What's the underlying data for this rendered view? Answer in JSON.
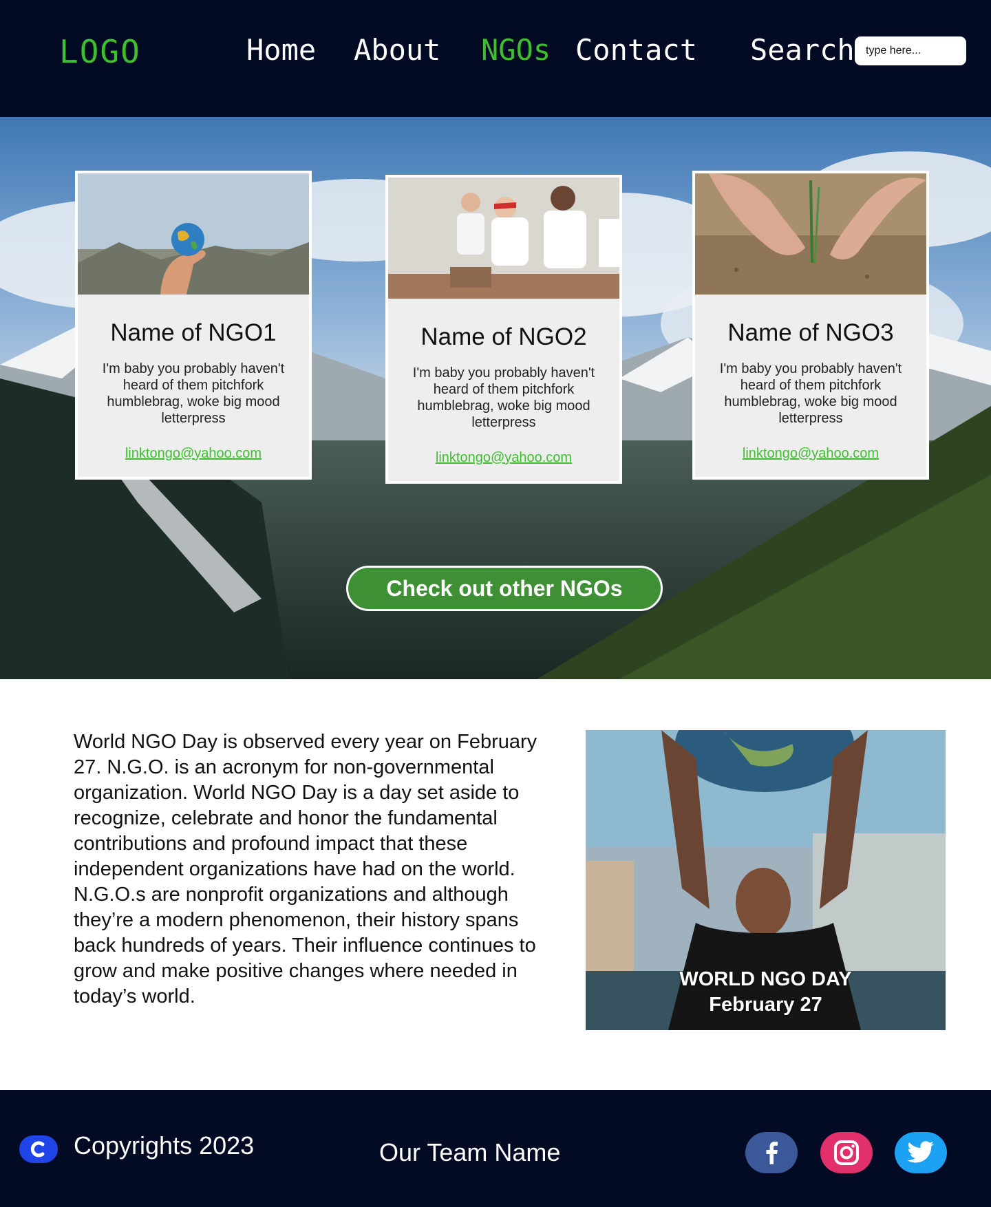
{
  "nav": {
    "logo": "LOGO",
    "links": [
      "Home",
      "About",
      "NGOs",
      "Contact"
    ],
    "active": "NGOs",
    "search_label": "Search",
    "search_placeholder": "type here..."
  },
  "cards": [
    {
      "title": "Name of NGO1",
      "text": "I'm baby you probably haven't heard of them pitchfork humblebrag, woke big mood letterpress",
      "link": "linktongo@yahoo.com",
      "photo": "hand-holding-globe"
    },
    {
      "title": "Name of NGO2",
      "text": "I'm baby you probably haven't heard of them pitchfork humblebrag, woke big mood letterpress",
      "link": "linktongo@yahoo.com",
      "photo": "volunteers"
    },
    {
      "title": "Name of NGO3",
      "text": "I'm baby you probably haven't heard of them pitchfork humblebrag, woke big mood letterpress",
      "link": "linktongo@yahoo.com",
      "photo": "hands-planting-seedling"
    }
  ],
  "cta_label": "Check out other NGOs",
  "about": {
    "text": "World NGO Day is observed every year on February 27. N.G.O. is an acronym for non-governmental organization. World NGO Day is a day set aside to recognize, celebrate and honor the fundamental contributions and profound impact that these independent organizations have had on the world. N.G.O.s are nonprofit organizations and although they’re a modern phenomenon, their history spans back hundreds of years. Their influence continues to grow and make positive changes where needed in today’s world.",
    "poster_line1": "WORLD NGO DAY",
    "poster_line2": "February 27"
  },
  "footer": {
    "copyright": "Copyrights 2023",
    "team": "Our Team Name",
    "social": [
      "facebook-icon",
      "instagram-icon",
      "twitter-icon"
    ]
  },
  "colors": {
    "navy": "#030a23",
    "accent_green": "#3fbf2f",
    "button_green": "#3f8f35",
    "card_bg": "#edeeed"
  }
}
